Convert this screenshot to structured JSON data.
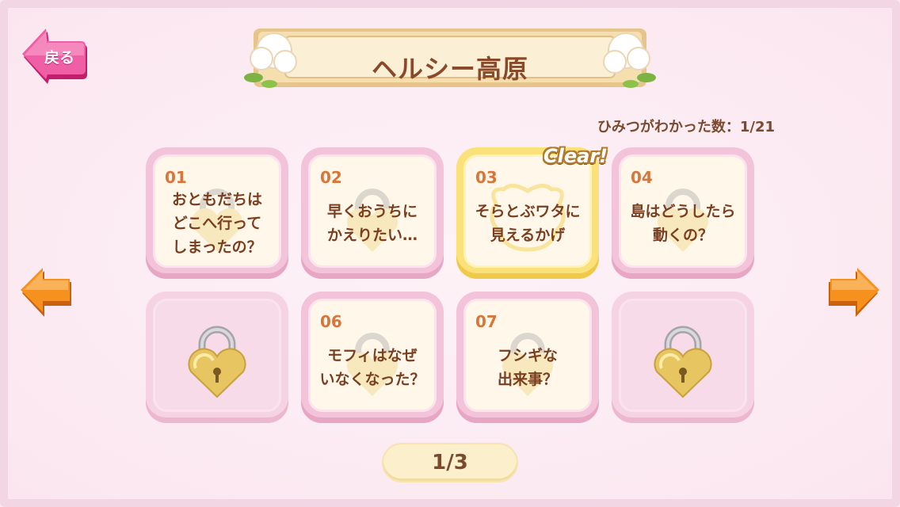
{
  "header": {
    "back_label": "戻る",
    "title": "ヘルシー高原"
  },
  "secret_count": "ひみつがわかった数：1/21",
  "clear_badge": "Clear!",
  "cards": [
    {
      "num": "01",
      "title": "おともだちは\nどこへ行って\nしまったの？",
      "state": "unlocked"
    },
    {
      "num": "02",
      "title": "早くおうちに\nかえりたい…",
      "state": "unlocked"
    },
    {
      "num": "03",
      "title": "そらとぶワタに\n見えるかげ",
      "state": "clear"
    },
    {
      "num": "04",
      "title": "島はどうしたら\n動くの？",
      "state": "unlocked"
    },
    {
      "num": "",
      "title": "",
      "state": "locked"
    },
    {
      "num": "06",
      "title": "モフィはなぜ\nいなくなった？",
      "state": "unlocked"
    },
    {
      "num": "07",
      "title": "フシギな\n出来事？",
      "state": "unlocked"
    },
    {
      "num": "",
      "title": "",
      "state": "locked"
    }
  ],
  "pagination": {
    "label": "1/3"
  },
  "icons": {
    "back": "arrow-left-icon",
    "prev": "arrow-left-icon",
    "next": "arrow-right-icon",
    "lock": "heart-padlock-icon"
  },
  "colors": {
    "background": "#fbe9f1",
    "back_button": "#ee4e9b",
    "arrows": "#f08a1e",
    "card_text": "#7a3e20",
    "card_number": "#d8753a"
  }
}
